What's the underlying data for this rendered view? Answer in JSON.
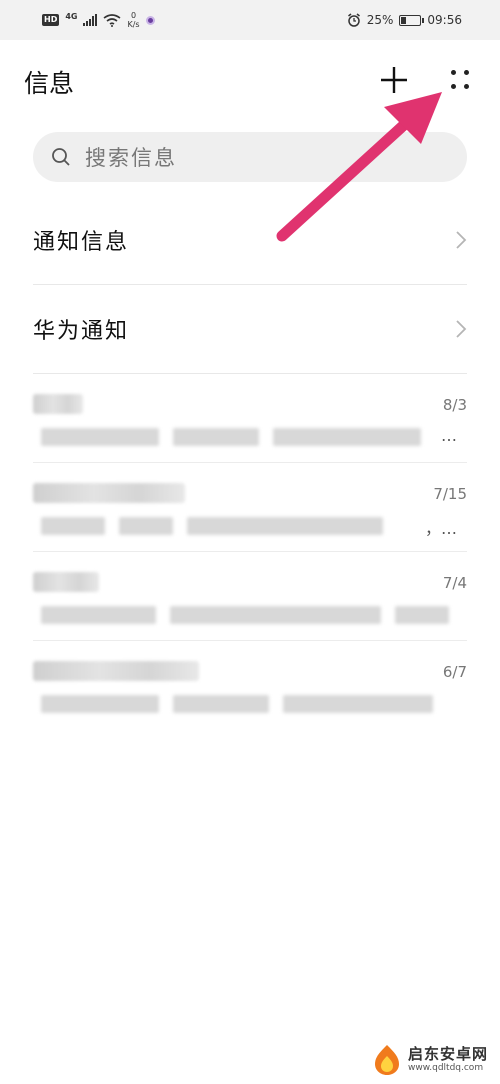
{
  "status_bar": {
    "hd": "HD",
    "net_gen": "4G",
    "net_speed_value": "0",
    "net_speed_unit": "K/s",
    "battery_percent": "25%",
    "battery_level": 0.25,
    "time": "09:56"
  },
  "header": {
    "title": "信息",
    "add_icon": "plus-icon",
    "more_icon": "more-dots-icon"
  },
  "search": {
    "placeholder": "搜索信息",
    "icon": "search-icon"
  },
  "notification_rows": [
    {
      "label": "通知信息",
      "icon": "chevron-right-icon"
    },
    {
      "label": "华为通知",
      "icon": "chevron-right-icon"
    }
  ],
  "messages": [
    {
      "date": "8/3",
      "ellipsis": "…"
    },
    {
      "date": "7/15",
      "ellipsis": "，…"
    },
    {
      "date": "7/4",
      "ellipsis": ""
    },
    {
      "date": "6/7",
      "ellipsis": ""
    }
  ],
  "annotation": {
    "color": "#e0336f"
  },
  "watermark": {
    "name": "启东安卓网",
    "url": "www.qdltdq.com"
  },
  "colors": {
    "status_bg": "#f2f2f2",
    "search_bg": "#efefef",
    "arrow": "#e0336f",
    "text_primary": "#111111",
    "text_secondary": "#777777"
  }
}
